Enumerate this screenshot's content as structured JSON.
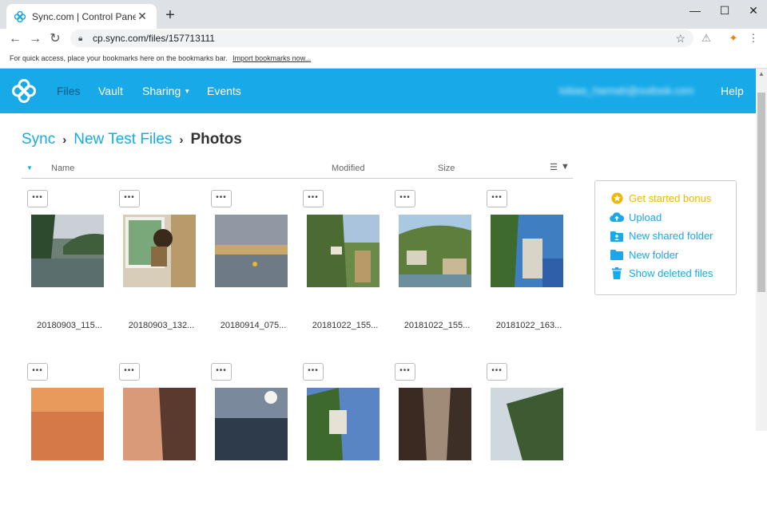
{
  "browser": {
    "tab_title": "Sync.com | Control Panel",
    "url": "cp.sync.com/files/157713111",
    "bookmarks_hint": "For quick access, place your bookmarks here on the bookmarks bar.",
    "import_bookmarks": "Import bookmarks now..."
  },
  "header": {
    "nav": [
      "Files",
      "Vault",
      "Sharing",
      "Events"
    ],
    "user": "tobias_hannah@outlook.com",
    "help": "Help"
  },
  "breadcrumb": {
    "root": "Sync",
    "parent": "New Test Files",
    "current": "Photos"
  },
  "columns": {
    "name": "Name",
    "modified": "Modified",
    "size": "Size"
  },
  "files": [
    {
      "name": "20180903_115...",
      "menu": "•••"
    },
    {
      "name": "20180903_132...",
      "menu": "•••"
    },
    {
      "name": "20180914_075...",
      "menu": "•••"
    },
    {
      "name": "20181022_155...",
      "menu": "•••"
    },
    {
      "name": "20181022_155...",
      "menu": "•••"
    },
    {
      "name": "20181022_163...",
      "menu": "•••"
    },
    {
      "name": "",
      "menu": "•••"
    },
    {
      "name": "",
      "menu": "•••"
    },
    {
      "name": "",
      "menu": "•••"
    },
    {
      "name": "",
      "menu": "•••"
    },
    {
      "name": "",
      "menu": "•••"
    },
    {
      "name": "",
      "menu": "•••"
    }
  ],
  "actions": {
    "bonus": "Get started bonus",
    "upload": "Upload",
    "new_shared_folder": "New shared folder",
    "new_folder": "New folder",
    "show_deleted": "Show deleted files"
  },
  "colors": {
    "brand": "#17a9e8",
    "bonus": "#f4b400"
  }
}
